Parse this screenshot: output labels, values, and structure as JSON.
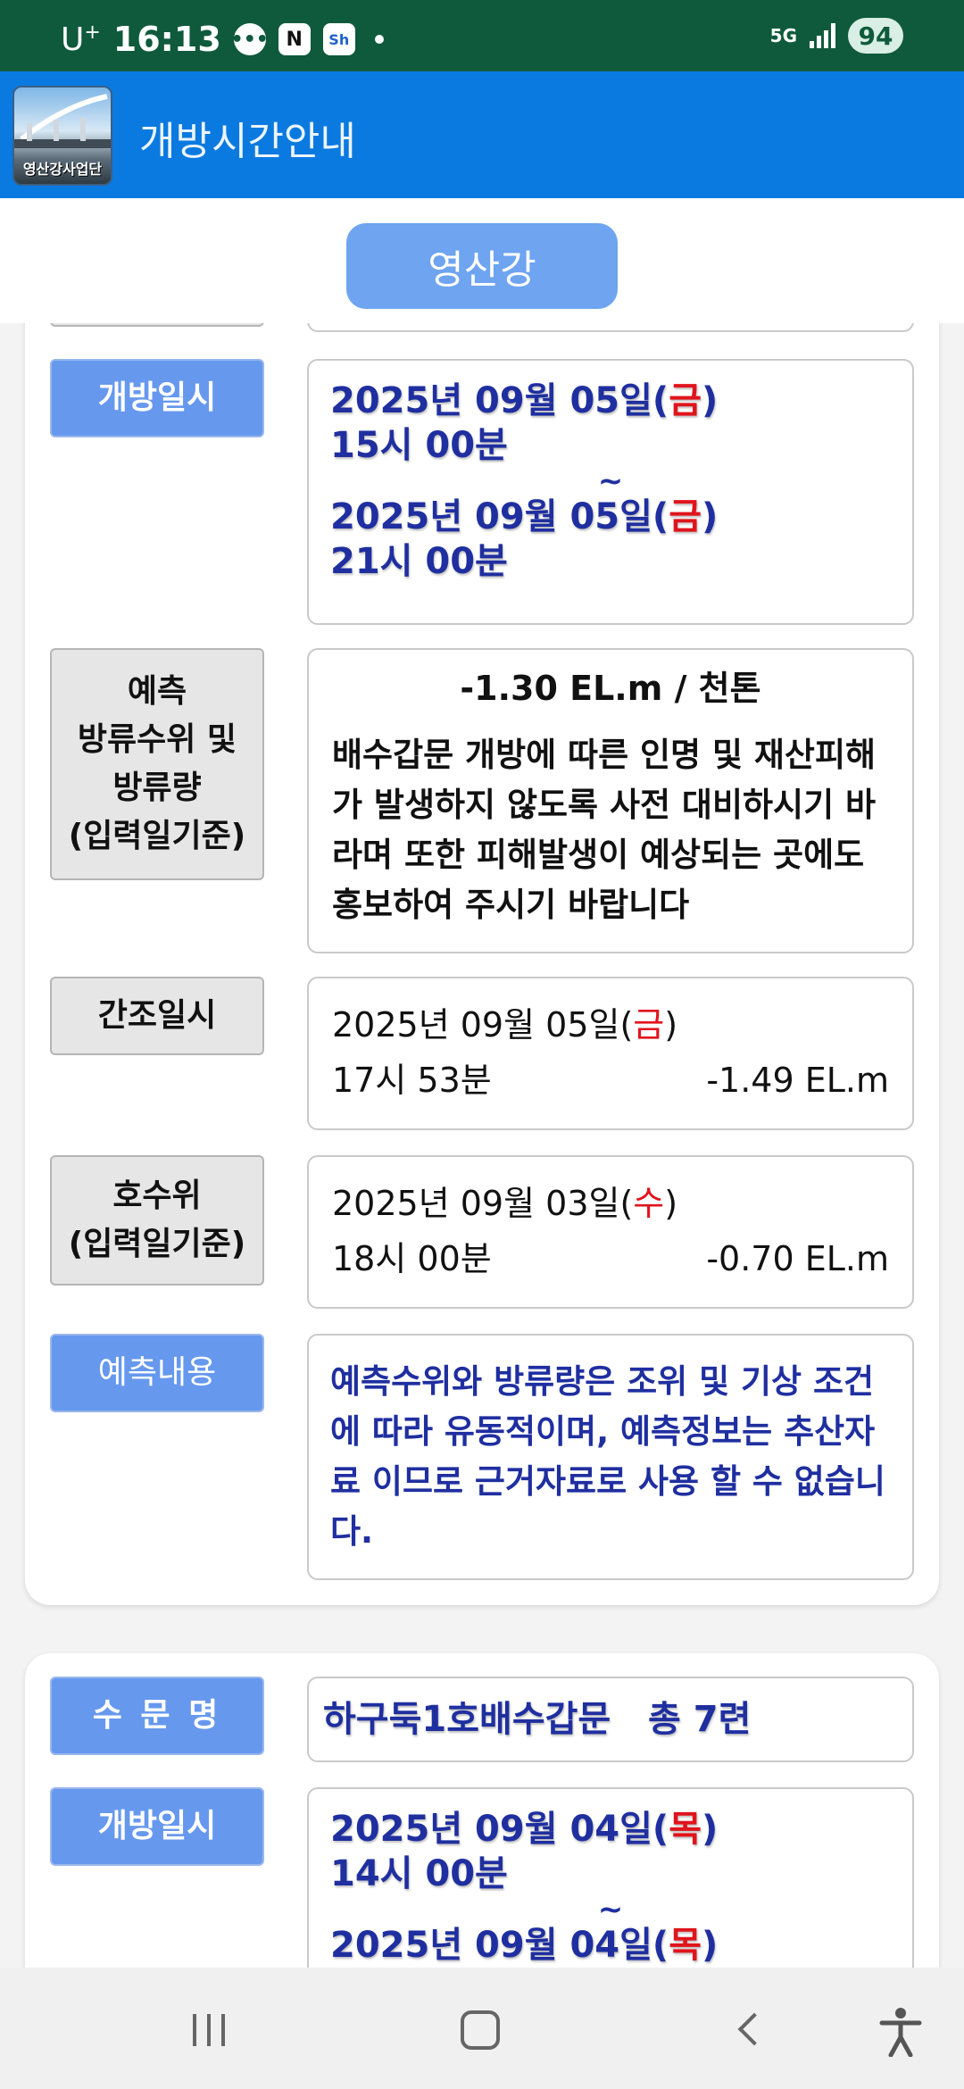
{
  "status_bar": {
    "carrier": "U",
    "carrier_sup": "+",
    "time": "16:13",
    "notif_icons": [
      "chat-bubble-icon",
      "naver-icon",
      "suhyup-sh-icon"
    ],
    "network": "5G",
    "battery": "94"
  },
  "app_bar": {
    "logo_text": "영산강사업단",
    "title": "개방시간안내"
  },
  "segment": {
    "label": "영산강"
  },
  "card1": {
    "open_label": "개방일시",
    "open_start_date": "2025년 09월 05일(",
    "open_start_day": "금",
    "open_start_close": ")",
    "open_start_time": "15시 00분",
    "tilde": "~",
    "open_end_date": "2025년 09월 05일(",
    "open_end_day": "금",
    "open_end_close": ")",
    "open_end_time": "21시 00분",
    "forecast_label_1": "예측",
    "forecast_label_2": "방류수위 및",
    "forecast_label_3": "방류량",
    "forecast_label_4": "(입력일기준)",
    "forecast_value": "-1.30 EL.m / 천톤",
    "forecast_notice": "배수갑문 개방에 따른 인명 및 재산피해가 발생하지 않도록 사전 대비하시기 바라며 또한 피해발생이 예상되는 곳에도 홍보하여 주시기 바랍니다",
    "lowtide_label": "간조일시",
    "lowtide_date": "2025년 09월 05일(",
    "lowtide_day": "금",
    "lowtide_close": ")",
    "lowtide_time": "17시 53분",
    "lowtide_level": "-1.49 EL.m",
    "lake_label_1": "호수위",
    "lake_label_2": "(입력일기준)",
    "lake_date": "2025년 09월 03일(",
    "lake_day": "수",
    "lake_close": ")",
    "lake_time": "18시 00분",
    "lake_level": "-0.70 EL.m",
    "content_label": "예측내용",
    "content_text": "예측수위와 방류량은 조위 및 기상 조건에 따라 유동적이며, 예측정보는 추산자료 이므로 근거자료로 사용 할 수 없습니다."
  },
  "card2": {
    "gate_label": "수 문 명",
    "gate_value": "하구둑1호배수갑문   총 7련",
    "open_label": "개방일시",
    "open_start_date": "2025년 09월 04일(",
    "open_start_day": "목",
    "open_start_close": ")",
    "open_start_time": "14시 00분",
    "tilde": "~",
    "open_end_date": "2025년 09월 04일(",
    "open_end_day": "목",
    "open_end_close": ")"
  },
  "colors": {
    "status_bar": "#0f5a3c",
    "app_bar": "#0a7ae0",
    "label_blue": "#6698ee",
    "date_navy": "#1f2fa0",
    "weekday_red": "#e0141c"
  }
}
